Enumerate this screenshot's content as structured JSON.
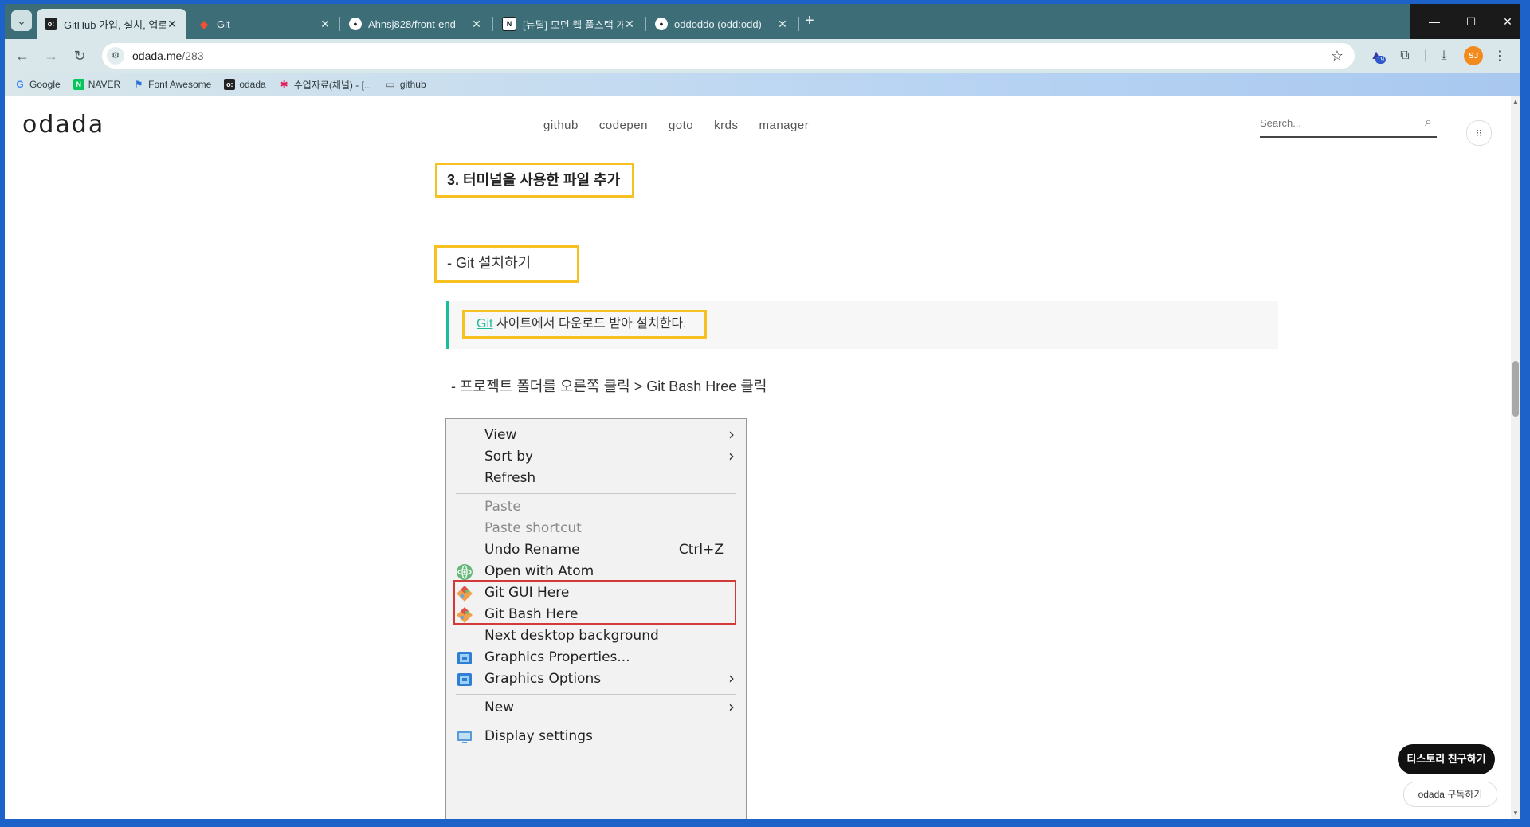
{
  "browser": {
    "tabs": [
      {
        "title": "GitHub 가입, 설치, 업로드하기",
        "favicon": "odada-favicon",
        "active": true
      },
      {
        "title": "Git",
        "favicon": "git-favicon",
        "active": false
      },
      {
        "title": "Ahnsj828/front-end",
        "favicon": "github-favicon",
        "active": false
      },
      {
        "title": "[뉴딜] 모던 웹 풀스택 개발자",
        "favicon": "notion-favicon",
        "active": false
      },
      {
        "title": "oddoddo (odd:odd)",
        "favicon": "github-favicon",
        "active": false
      }
    ],
    "address": {
      "host": "odada.me",
      "path": "/283"
    },
    "extension_badge": "19",
    "avatar_initials": "SJ",
    "bookmarks": [
      {
        "label": "Google",
        "icon": "google-icon"
      },
      {
        "label": "NAVER",
        "icon": "naver-icon"
      },
      {
        "label": "Font Awesome",
        "icon": "flag-icon"
      },
      {
        "label": "odada",
        "icon": "odada-icon"
      },
      {
        "label": "수업자료(채널) - [...",
        "icon": "slack-icon"
      },
      {
        "label": "github",
        "icon": "folder-icon"
      }
    ]
  },
  "site": {
    "logo": "odada",
    "nav": [
      "github",
      "codepen",
      "goto",
      "krds",
      "manager"
    ],
    "search_placeholder": "Search..."
  },
  "article": {
    "heading": "3. 터미널을 사용한 파일 추가",
    "subheading": "- Git 설치하기",
    "quote_link": "Git",
    "quote_text": " 사이트에서 다운로드 받아 설치한다.",
    "paragraph": "- 프로젝트 폴더를 오른쪽 클릭 > Git Bash Hree 클릭"
  },
  "context_menu": {
    "items": [
      {
        "label": "View",
        "submenu": true
      },
      {
        "label": "Sort by",
        "submenu": true
      },
      {
        "label": "Refresh"
      },
      {
        "label": "Paste",
        "disabled": true
      },
      {
        "label": "Paste shortcut",
        "disabled": true
      },
      {
        "label": "Undo Rename",
        "shortcut": "Ctrl+Z"
      },
      {
        "label": "Open with Atom",
        "icon": "atom-icon"
      },
      {
        "label": "Git GUI Here",
        "icon": "git-icon"
      },
      {
        "label": "Git Bash Here",
        "icon": "git-icon"
      },
      {
        "label": "Next desktop background"
      },
      {
        "label": "Graphics Properties...",
        "icon": "intel-graphics-icon"
      },
      {
        "label": "Graphics Options",
        "icon": "intel-graphics-icon",
        "submenu": true
      },
      {
        "label": "New",
        "submenu": true
      },
      {
        "label": "Display settings",
        "icon": "display-icon"
      }
    ]
  },
  "floating": {
    "friend_button": "티스토리 친구하기",
    "subscribe_button": "odada 구독하기"
  },
  "colors": {
    "titlebar": "#3d6e78",
    "toolbar": "#d9e7ea",
    "highlight_box": "#f5c020",
    "quote_accent": "#1abc9c",
    "context_red_box": "#d23a3a"
  }
}
